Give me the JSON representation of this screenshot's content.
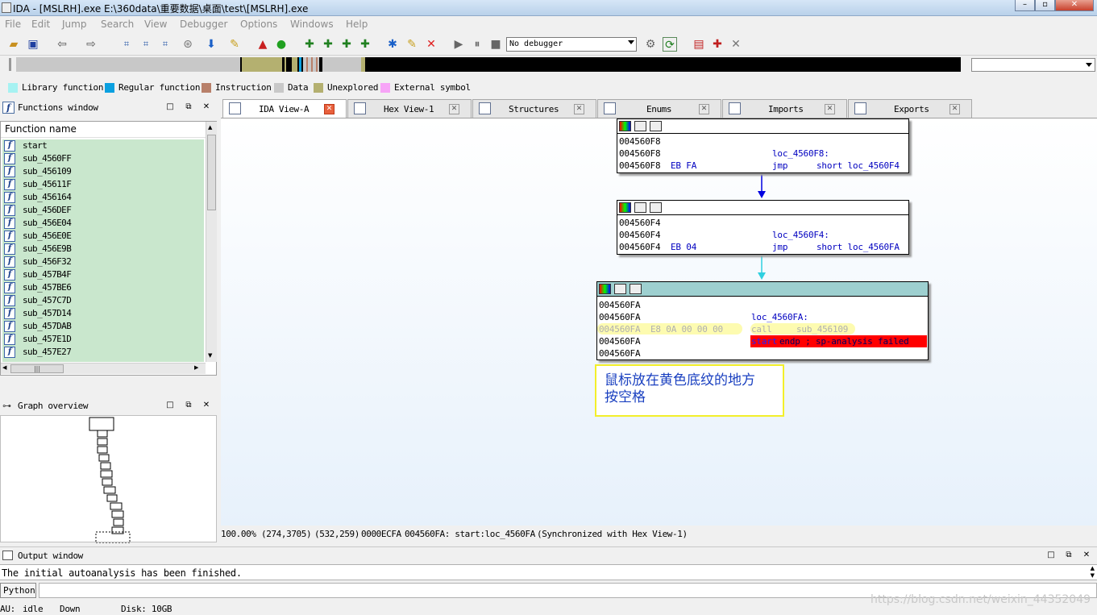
{
  "window": {
    "title": "IDA - [MSLRH].exe E:\\360data\\重要数据\\桌面\\test\\[MSLRH].exe"
  },
  "menu": [
    "File",
    "Edit",
    "Jump",
    "Search",
    "View",
    "Debugger",
    "Options",
    "Windows",
    "Help"
  ],
  "toolbar": {
    "debugger_select": "No debugger"
  },
  "legend": [
    {
      "label": "Library function",
      "color": "#a6f2f2"
    },
    {
      "label": "Regular function",
      "color": "#0aa0e0"
    },
    {
      "label": "Instruction",
      "color": "#b8806a"
    },
    {
      "label": "Data",
      "color": "#c8c8c8"
    },
    {
      "label": "Unexplored",
      "color": "#b4b070"
    },
    {
      "label": "External symbol",
      "color": "#f7a4f7"
    }
  ],
  "functions_window": {
    "title": "Functions window",
    "column": "Function name",
    "items": [
      "start",
      "sub_4560FF",
      "sub_456109",
      "sub_45611F",
      "sub_456164",
      "sub_456DEF",
      "sub_456E04",
      "sub_456E0E",
      "sub_456E9B",
      "sub_456F32",
      "sub_457B4F",
      "sub_457BE6",
      "sub_457C7D",
      "sub_457D14",
      "sub_457DAB",
      "sub_457E1D",
      "sub_457E27"
    ]
  },
  "graph_overview": {
    "title": "Graph overview"
  },
  "tabs": [
    {
      "label": "IDA View-A",
      "active": true
    },
    {
      "label": "Hex View-1",
      "active": false
    },
    {
      "label": "Structures",
      "active": false
    },
    {
      "label": "Enums",
      "active": false
    },
    {
      "label": "Imports",
      "active": false
    },
    {
      "label": "Exports",
      "active": false
    }
  ],
  "nodes": {
    "n1": {
      "lines": [
        {
          "addr": "004560F8",
          "bytes": "",
          "label": "",
          "op": "",
          "arg": ""
        },
        {
          "addr": "004560F8",
          "bytes": "",
          "label": "loc_4560F8:",
          "op": "",
          "arg": ""
        },
        {
          "addr": "004560F8",
          "bytes": "EB FA",
          "label": "",
          "op": "jmp",
          "arg": "short loc_4560F4"
        }
      ]
    },
    "n2": {
      "lines": [
        {
          "addr": "004560F4",
          "bytes": "",
          "label": "",
          "op": "",
          "arg": ""
        },
        {
          "addr": "004560F4",
          "bytes": "",
          "label": "loc_4560F4:",
          "op": "",
          "arg": ""
        },
        {
          "addr": "004560F4",
          "bytes": "EB 04",
          "label": "",
          "op": "jmp",
          "arg": "short loc_4560FA"
        }
      ]
    },
    "n3": {
      "l1": "004560FA",
      "l2_addr": "004560FA",
      "l2_label": "loc_4560FA:",
      "l3_addr": "004560FA",
      "l3_bytes": "E8 0A 00 00 00",
      "l3_op": "call",
      "l3_arg": "sub_456109",
      "l4_addr": "004560FA",
      "l4_kw": "start",
      "l4_rest": " endp ; sp-analysis failed",
      "l5": "004560FA"
    }
  },
  "annotation": {
    "line1": "鼠标放在黄色底纹的地方",
    "line2": "按空格"
  },
  "status": {
    "zoom": "100.00%",
    "graph_pos": "(274,3705)",
    "mouse_pos": "(532,259)",
    "offset": "0000ECFA",
    "location": "004560FA: start:loc_4560FA",
    "sync": "(Synchronized with Hex View-1)"
  },
  "output": {
    "title": "Output window",
    "text": "The initial autoanalysis has been finished.",
    "python_button": "Python"
  },
  "bottom": {
    "au": "AU:",
    "au_state": "idle",
    "direction": "Down",
    "disk": "Disk: 10GB"
  },
  "watermark": "https://blog.csdn.net/weixin_44352049"
}
